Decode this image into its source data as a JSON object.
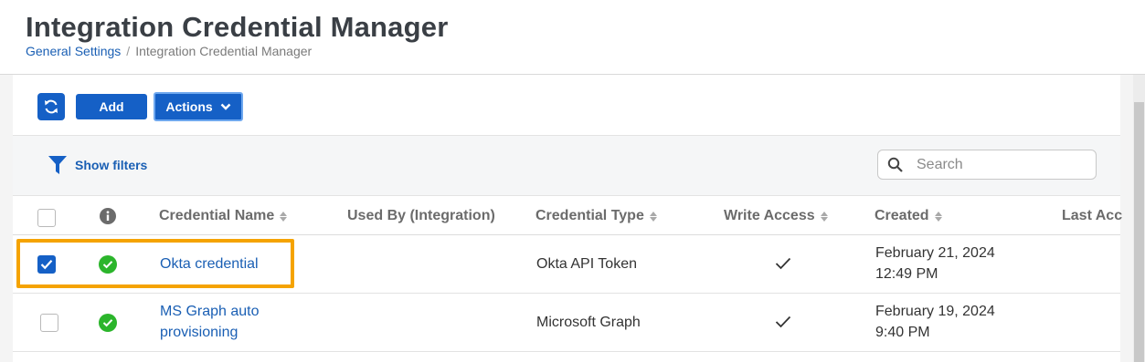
{
  "header": {
    "title": "Integration Credential Manager",
    "breadcrumb": {
      "parent": "General Settings",
      "separator": "/",
      "current": "Integration Credential Manager"
    }
  },
  "toolbar": {
    "refresh_icon": "refresh-icon",
    "add_label": "Add",
    "actions_label": "Actions"
  },
  "filters": {
    "show_filters_label": "Show filters",
    "search_placeholder": "Search",
    "search_value": ""
  },
  "table": {
    "columns": {
      "info_icon": "info-icon",
      "credential_name": "Credential Name",
      "used_by": "Used By (Integration)",
      "credential_type": "Credential Type",
      "write_access": "Write Access",
      "created": "Created",
      "last_access": "Last Acc"
    },
    "rows": [
      {
        "selected": true,
        "status": "ok",
        "name": "Okta credential",
        "name_line2": "",
        "used_by": "",
        "type": "Okta API Token",
        "write_access": true,
        "created_date": "February 21, 2024",
        "created_time": "12:49 PM"
      },
      {
        "selected": false,
        "status": "ok",
        "name": "MS Graph auto",
        "name_line2": "provisioning",
        "used_by": "",
        "type": "Microsoft Graph",
        "write_access": true,
        "created_date": "February 19, 2024",
        "created_time": "9:40 PM"
      }
    ]
  },
  "colors": {
    "primary": "#1560c6",
    "link": "#1a5fb4",
    "success": "#2bb52b",
    "highlight": "#f5a300"
  }
}
